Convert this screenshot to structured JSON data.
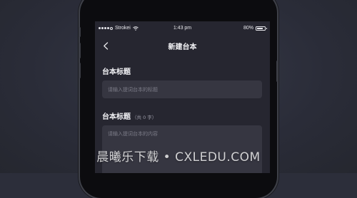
{
  "status_bar": {
    "carrier": "Strokei",
    "time": "1:43 pm",
    "battery_percent_label": "80%",
    "battery_level": 0.8,
    "signal_bars_on": 4,
    "signal_bars_total": 5
  },
  "nav": {
    "title": "新建台本",
    "back_icon": "chevron-left-icon"
  },
  "form": {
    "title_label": "台本标题",
    "title_placeholder": "请输入提词台本的标题",
    "content_label": "台本标题",
    "content_hint": "（共 0 字）",
    "content_placeholder": "请输入提词台本的内容"
  },
  "watermark": {
    "text": "晨曦乐下载 • CXLEDU.COM"
  },
  "colors": {
    "background": "#2c2e3a",
    "screen": "#262630",
    "input": "#363641",
    "text": "#f0f0f3",
    "placeholder": "#7c7c88"
  }
}
